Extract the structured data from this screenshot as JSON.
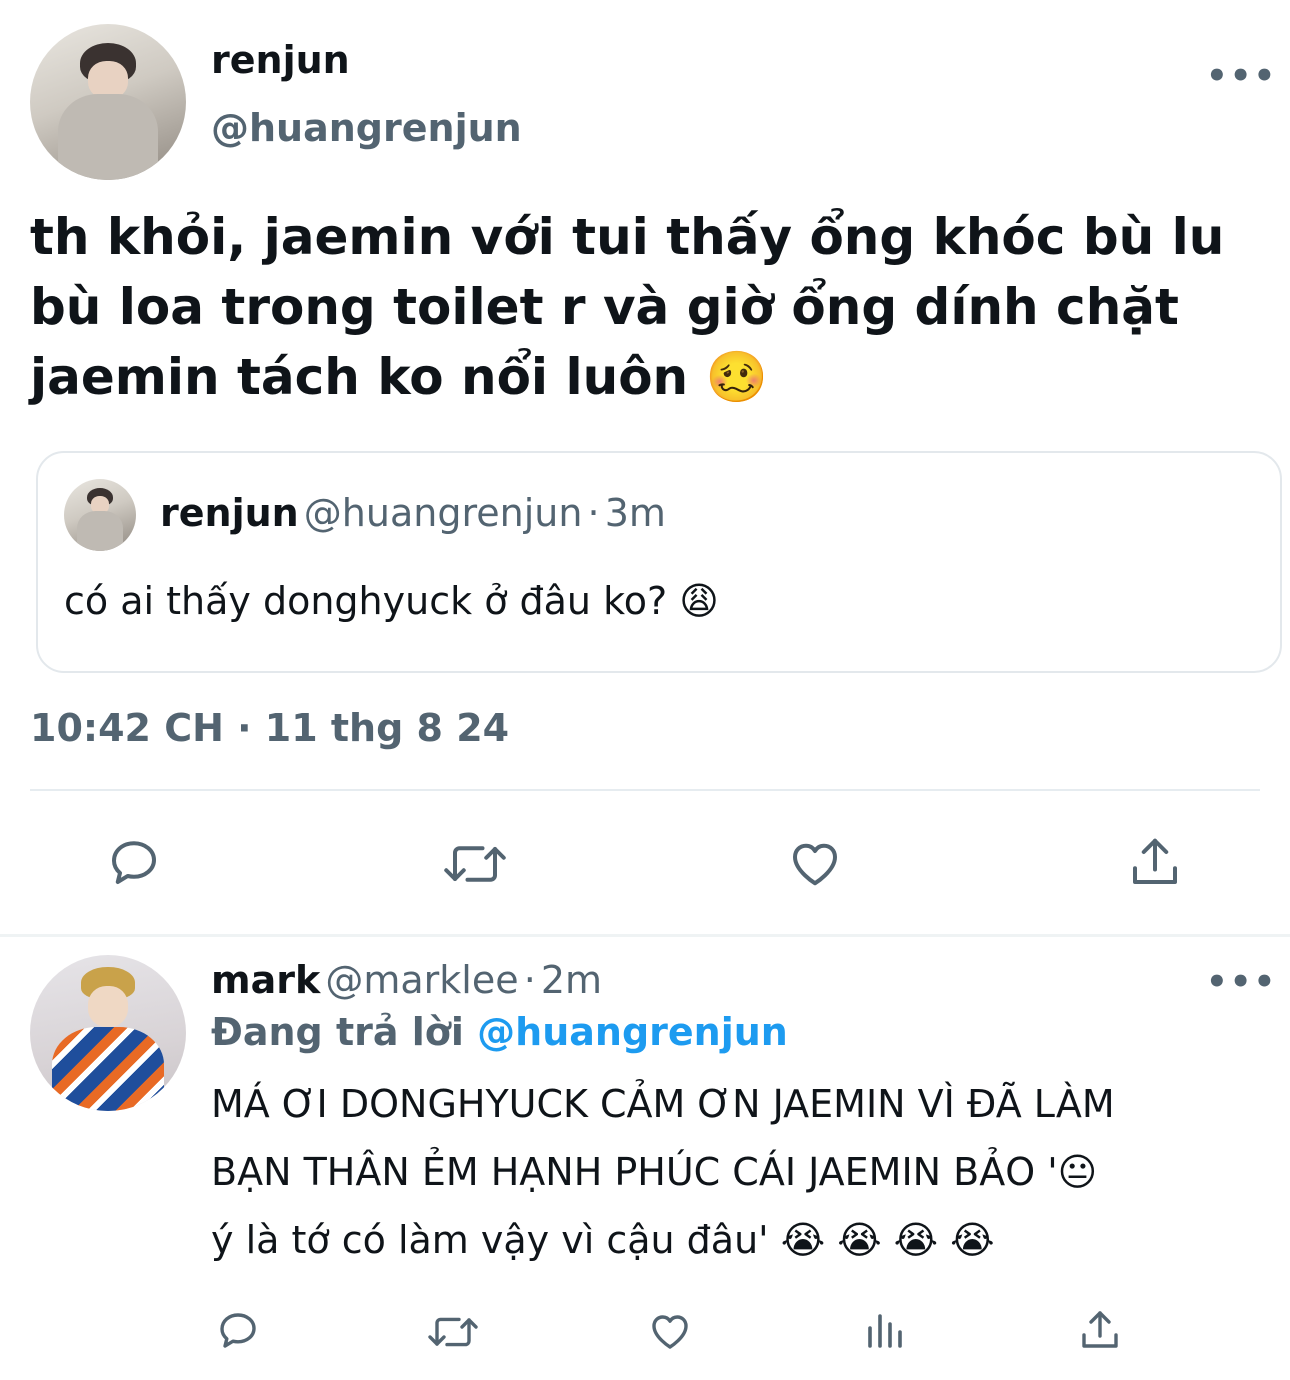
{
  "main_tweet": {
    "display_name": "renjun",
    "handle": "@huangrenjun",
    "text": "th khỏi, jaemin với tui thấy ổng khóc bù lu bù loa trong toilet r và giờ ổng dính chặt jaemin tách ko nổi luôn",
    "emoji": "🥴",
    "timestamp": "10:42 CH · 11 thg 8 24",
    "more_label": "•••"
  },
  "quoted_tweet": {
    "display_name": "renjun",
    "handle": "@huangrenjun",
    "separator": "·",
    "time": "3m",
    "text": "có ai thấy donghyuck ở đâu ko?",
    "emoji": "😩"
  },
  "action_bar": {
    "icons": [
      "reply-icon",
      "retweet-icon",
      "like-icon",
      "share-icon"
    ]
  },
  "reply": {
    "display_name": "mark",
    "handle": "@marklee",
    "separator": "·",
    "time": "2m",
    "replying_label": "Đang trả lời",
    "replying_to": "@huangrenjun",
    "line1": "MÁ ƠI DONGHYUCK CẢM ƠN JAEMIN VÌ ĐÃ LÀM",
    "line2": "BẠN THÂN ẺM HẠNH PHÚC CÁI JAEMIN BẢO '",
    "line2_emoji": "😐",
    "line3": "ý là tớ có làm vậy vì cậu đâu'",
    "line3_emoji": "😭 😭 😭 😭",
    "more_label": "•••",
    "icons": [
      "reply-icon",
      "retweet-icon",
      "like-icon",
      "analytics-icon",
      "share-icon"
    ]
  },
  "colors": {
    "text": "#0f1419",
    "secondary": "#536471",
    "accent": "#1d9bf0",
    "border": "#e3e8ec"
  }
}
